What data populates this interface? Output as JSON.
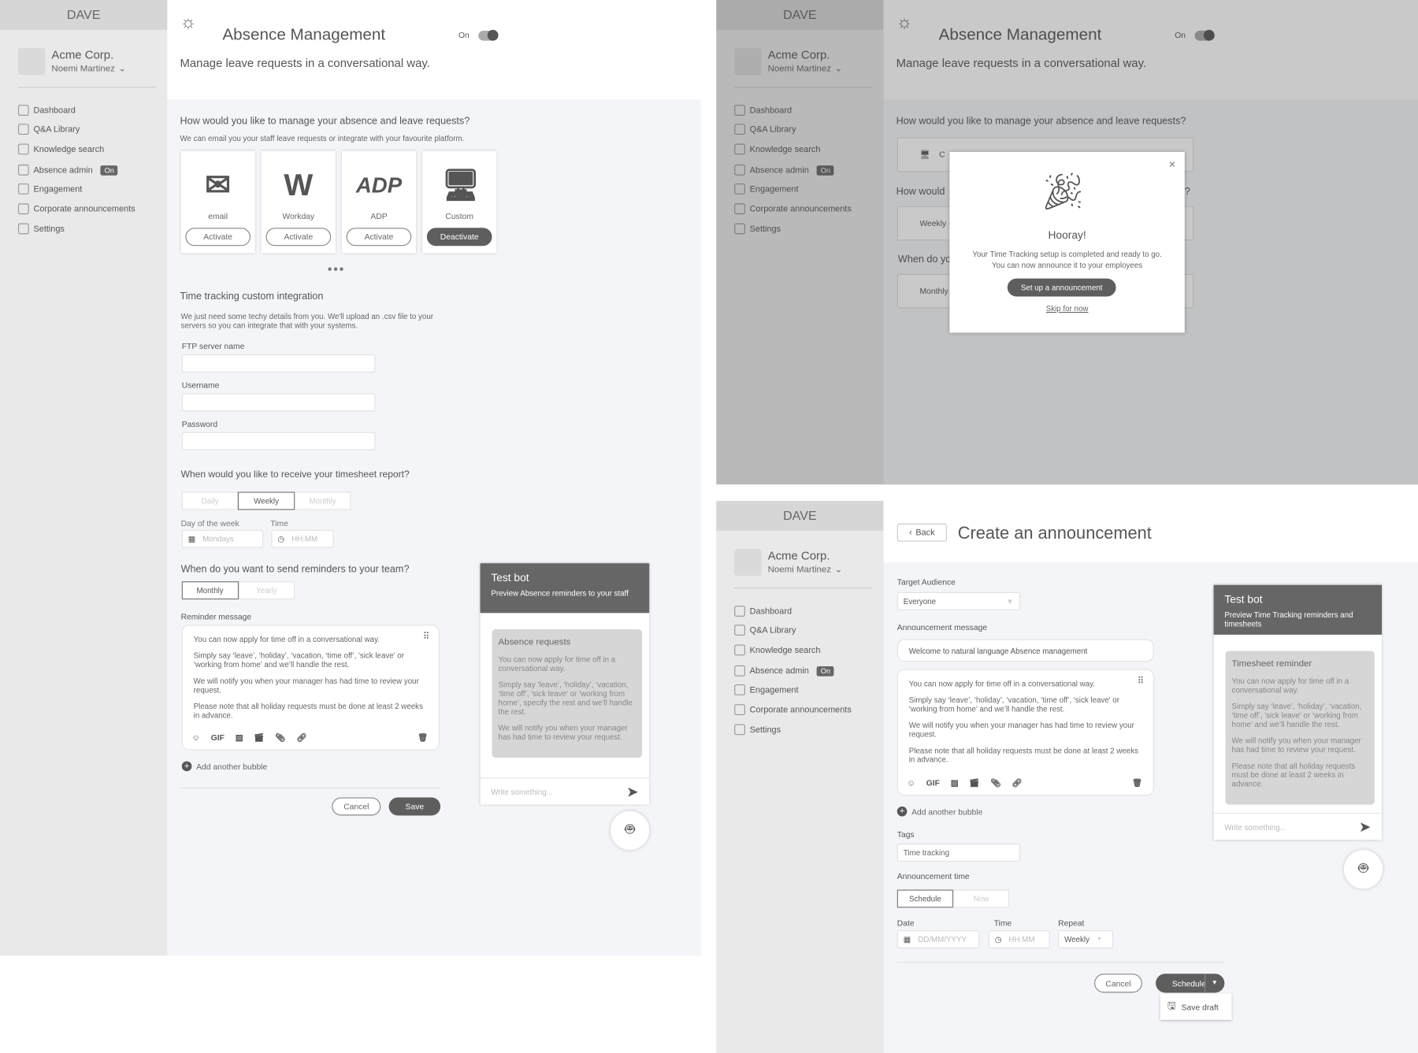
{
  "sidebar": {
    "brand": "DAVE",
    "org": "Acme Corp.",
    "user": "Noemi Martinez",
    "items": [
      {
        "label": "Dashboard",
        "icon": "dashboard-icon"
      },
      {
        "label": "Q&A Library",
        "icon": "qa-library-icon"
      },
      {
        "label": "Knowledge search",
        "icon": "knowledge-search-icon"
      },
      {
        "label": "Absence admin",
        "icon": "absence-icon",
        "badge": "On"
      },
      {
        "label": "Engagement",
        "icon": "engagement-icon"
      },
      {
        "label": "Corporate announcements",
        "icon": "broadcast-icon"
      },
      {
        "label": "Settings",
        "icon": "gear-icon"
      }
    ]
  },
  "absence": {
    "title": "Absence Management",
    "toggle_label": "On",
    "toggle_on": true,
    "subtitle": "Manage leave requests in a conversational way.",
    "question": "How would you like to manage your absence and leave requests?",
    "question_sub": "We can email you your staff leave requests or integrate with your favourite platform.",
    "integrations": [
      {
        "name": "email",
        "button": "Activate",
        "active": false,
        "icon": "email-icon"
      },
      {
        "name": "Workday",
        "button": "Activate",
        "active": false,
        "icon": "workday-logo"
      },
      {
        "name": "ADP",
        "button": "Activate",
        "active": false,
        "icon": "adp-logo"
      },
      {
        "name": "Custom",
        "button": "Deactivate",
        "active": true,
        "icon": "custom-integration-icon"
      }
    ],
    "custom_title": "Time tracking custom integration",
    "custom_desc_1": "We just need some techy details from you. We'll upload an .csv file to your",
    "custom_desc_2": "servers so you can integrate that with your systems.",
    "ftp_label": "FTP server name",
    "username_label": "Username",
    "password_label": "Password",
    "report_question": "When would you like to receive your timesheet report?",
    "report_options": [
      "Daily",
      "Weekly",
      "Monthly"
    ],
    "report_selected": "Weekly",
    "day_label": "Day of the week",
    "day_placeholder": "Mondays",
    "time_label": "Time",
    "time_placeholder": "HH:MM",
    "reminder_question": "When do you want to send reminders to your team?",
    "reminder_options": [
      "Monthly",
      "Yearly"
    ],
    "reminder_selected": "Monthly",
    "reminder_label": "Reminder message",
    "message": [
      "You can now apply for time off in a conversational way.",
      "Simply say ‘leave’, ‘holiday’, ‘vacation, ‘time off’, 'sick leave' or ‘working from home’ and we’ll handle the rest.",
      "We will notify you when your manager has had time to review your request.",
      "Please note that all holiday requests must be done at least 2 weeks in advance."
    ],
    "toolbar": {
      "gif": "GIF"
    },
    "add_bubble": "Add another bubble",
    "cancel": "Cancel",
    "save": "Save",
    "bot": {
      "title": "Test bot",
      "subtitle": "Preview Absence reminders to your staff",
      "bubble_title": "Absence requests",
      "bubble": [
        "You can now apply for time off in a conversational way.",
        "Simply say ‘leave’, ‘holiday’, ‘vacation, ‘time off’, 'sick leave' or ‘working from home’, specify the rest and we’ll handle the rest.",
        "We will notify you when your manager has had time to review your request."
      ],
      "placeholder": "Write something..."
    }
  },
  "overview": {
    "list": [
      {
        "label": "C"
      },
      {
        "label": "Weekly -"
      },
      {
        "label": "Monthly -"
      }
    ],
    "q2": "How would",
    "q2_end": "?",
    "q3": "When do yo"
  },
  "modal": {
    "title": "Hooray!",
    "line1": "Your Time Tracking setup is completed and ready to go.",
    "line2": "You can now announce it to your employees",
    "primary": "Set up a announcement",
    "skip": "Skip for now"
  },
  "announcement": {
    "back": "Back",
    "title": "Create an announcement",
    "audience_label": "Target Audience",
    "audience_value": "Everyone",
    "message_label": "Announcement message",
    "message_value": "Welcome to natural language Absence management",
    "message": [
      "You can now apply for time off in a conversational way.",
      "Simply say ‘leave’, ‘holiday’, ‘vacation, ‘time off’, 'sick leave' or ‘working from home’ and we’ll handle the rest.",
      "We will notify you when your manager has had time to review your request.",
      "Please note that all holiday requests must be done at least 2 weeks in advance."
    ],
    "add_bubble": "Add another bubble",
    "tags_label": "Tags",
    "tags_value": "Time tracking",
    "time_label": "Announcement time",
    "time_options": [
      "Schedule",
      "Now"
    ],
    "time_selected": "Schedule",
    "date_label": "Date",
    "date_placeholder": "DD/MM/YYYY",
    "clock_label": "Time",
    "clock_placeholder": "HH:MM",
    "repeat_label": "Repeat",
    "repeat_value": "Weekly",
    "cancel": "Cancel",
    "schedule": "Schedule",
    "save_draft": "Save draft",
    "bot": {
      "title": "Test bot",
      "subtitle": "Preview Time Tracking reminders and timesheets",
      "bubble_title": "Timesheet reminder",
      "bubble": [
        "You can now apply for time off in a conversational way.",
        "Simply say ‘leave’, ‘holiday’, ‘vacation, ‘time off’, 'sick leave' or ‘working from home’ and we’ll handle the rest.",
        "We will notify you when your manager has had time to review your request.",
        "Please note that all holiday requests must be done at least 2 weeks in advance."
      ],
      "placeholder": "Write something..."
    }
  },
  "colors": {
    "dark": "#5e5e5e",
    "sidebar": "#e9e9e9",
    "content_bg": "#f4f5f8"
  }
}
